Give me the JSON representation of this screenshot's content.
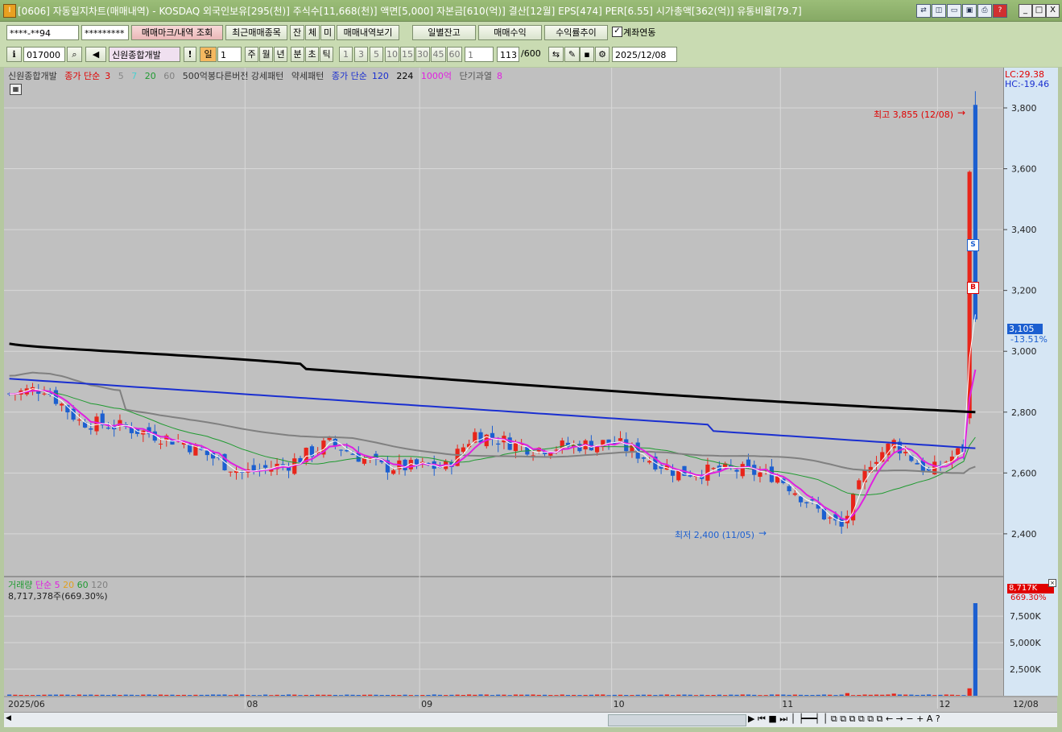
{
  "window": {
    "title": "[0606] 자동일지차트(매매내역) - KOSDAQ 외국인보유[295(천)] 주식수[11,668(천)] 액면[5,000] 자본금[610(억)] 결산[12월] EPS[474] PER[6.55] 시가총액[362(억)] 유통비율[79.7]",
    "min": "_",
    "max": "□",
    "close": "X"
  },
  "toolbar1": {
    "account": "****-**94",
    "password": "*********",
    "btn_trade_mark": "매매마크/내역 조회",
    "btn_recent": "최근매매종목",
    "btn_jan": "잔",
    "btn_che": "체",
    "btn_mi": "미",
    "btn_history": "매매내역보기",
    "btn_daily_balance": "일별잔고",
    "btn_trade_profit": "매매수익",
    "btn_return_trend": "수익률추이",
    "chk_link_label": "계좌연동"
  },
  "toolbar2": {
    "code": "017000",
    "name": "신원종합개발",
    "period_day": "일",
    "period_num": "1",
    "period_week": "주",
    "period_month": "월",
    "period_year": "년",
    "period_min": "분",
    "period_sec": "초",
    "period_tick": "틱",
    "min_options": [
      "1",
      "3",
      "5",
      "10",
      "15",
      "30",
      "45",
      "60"
    ],
    "count_sel": "1",
    "count": "113",
    "count_max": "/600",
    "date": "2025/12/08"
  },
  "legend": {
    "name": "신원종합개발",
    "ma_label": "종가 단순",
    "ma1": "3",
    "ma2": "5",
    "ma3": "7",
    "ma4": "20",
    "ma5": "60",
    "pattern": "500억봉다른버전 강세패턴",
    "weak": "약세패턴",
    "ma_label2": "종가 단순",
    "ma6": "120",
    "ma7": "224",
    "bil": "1000억",
    "over": "단기과열",
    "over_n": "8"
  },
  "right_info": {
    "lc": "LC:29.38",
    "hc": "HC:-19.46",
    "price": "3,105",
    "pct": "-13.51%"
  },
  "annotations": {
    "high": "최고 3,855 (12/08)",
    "low": "최저 2,400 (11/05)"
  },
  "volume": {
    "label": "거래량",
    "ma_label": "단순",
    "n1": "5",
    "n2": "20",
    "n3": "60",
    "n4": "120",
    "value": "8,717,378주(669.30%)",
    "badge": "8,717K",
    "badge_pct": "669.30%"
  },
  "chart_data": {
    "type": "candlestick",
    "y_ticks": [
      "3,800",
      "3,600",
      "3,400",
      "3,200",
      "3,000",
      "2,800",
      "2,600",
      "2,400"
    ],
    "y_ticks_values": [
      3800,
      3600,
      3400,
      3200,
      3000,
      2800,
      2600,
      2400
    ],
    "ylim": [
      2270,
      3890
    ],
    "vol_ticks": [
      "7,500K",
      "5,000K",
      "2,500K"
    ],
    "vol_ticks_values": [
      7500,
      5000,
      2500
    ],
    "vol_ylim": [
      0,
      9400
    ],
    "x_labels": [
      "2025/06",
      "08",
      "09",
      "10",
      "11",
      "12",
      "12/08"
    ],
    "x_label_index": [
      0,
      41,
      71,
      104,
      133,
      160,
      -1
    ],
    "current": 3105,
    "high": 3855,
    "low": 2400,
    "ma224_start": 3025,
    "ma224_end": 2800
  },
  "colors": {
    "up": "#e8251a",
    "down": "#1c5fd0",
    "ma224": "#000000",
    "ma120": "#1a2fd0",
    "ma60": "#808080",
    "ma20": "#1f9a30",
    "ma5": "#e020e0"
  }
}
